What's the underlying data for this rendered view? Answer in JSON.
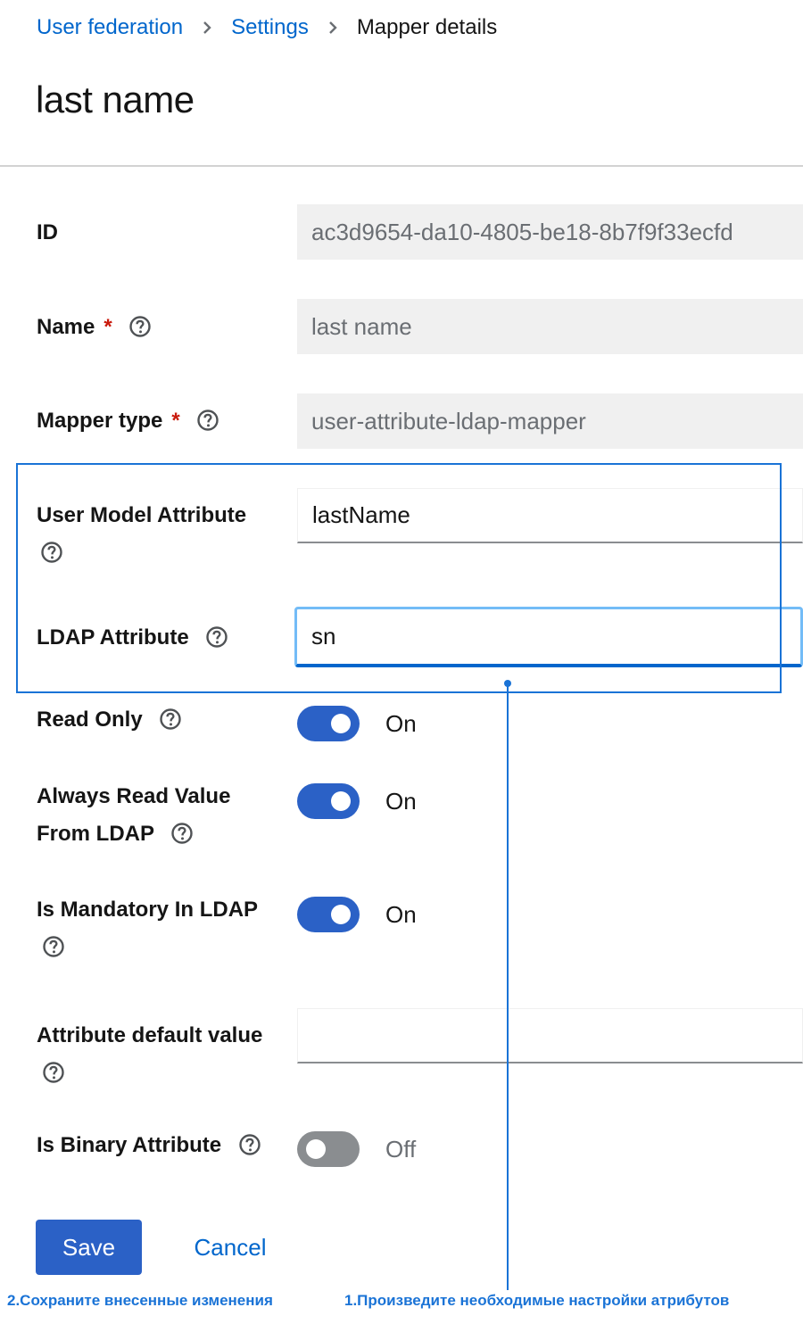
{
  "breadcrumb": {
    "items": [
      "User federation",
      "Settings"
    ],
    "current": "Mapper details"
  },
  "page": {
    "title": "last name"
  },
  "form": {
    "id": {
      "label": "ID",
      "value": "ac3d9654-da10-4805-be18-8b7f9f33ecfd"
    },
    "name": {
      "label": "Name",
      "required_mark": "*",
      "value": "last name"
    },
    "mapper_type": {
      "label": "Mapper type",
      "required_mark": "*",
      "value": "user-attribute-ldap-mapper"
    },
    "user_model_attribute": {
      "label": "User Model Attribute",
      "value": "lastName"
    },
    "ldap_attribute": {
      "label": "LDAP Attribute",
      "value": "sn"
    },
    "read_only": {
      "label": "Read Only",
      "state": true,
      "state_label": "On"
    },
    "always_read_value": {
      "label_line1": "Always Read Value",
      "label_line2": "From LDAP",
      "state": true,
      "state_label": "On"
    },
    "is_mandatory": {
      "label": "Is Mandatory In LDAP",
      "state": true,
      "state_label": "On"
    },
    "attribute_default_value": {
      "label": "Attribute default value",
      "value": ""
    },
    "is_binary": {
      "label": "Is Binary Attribute",
      "state": false,
      "state_label": "Off"
    }
  },
  "actions": {
    "save_label": "Save",
    "cancel_label": "Cancel"
  },
  "annotations": {
    "save_note": "2.Сохраните внесенные изменения",
    "attributes_note": "1.Произведите необходимые настройки атрибутов"
  },
  "colors": {
    "primary": "#2b61c6",
    "link": "#0066cc",
    "required": "#c9190b",
    "annotation": "#1a73d6",
    "readonly_bg": "#f0f0f0"
  },
  "icons": {
    "breadcrumb_separator": "chevron-right-icon",
    "help": "help-circle-icon"
  }
}
